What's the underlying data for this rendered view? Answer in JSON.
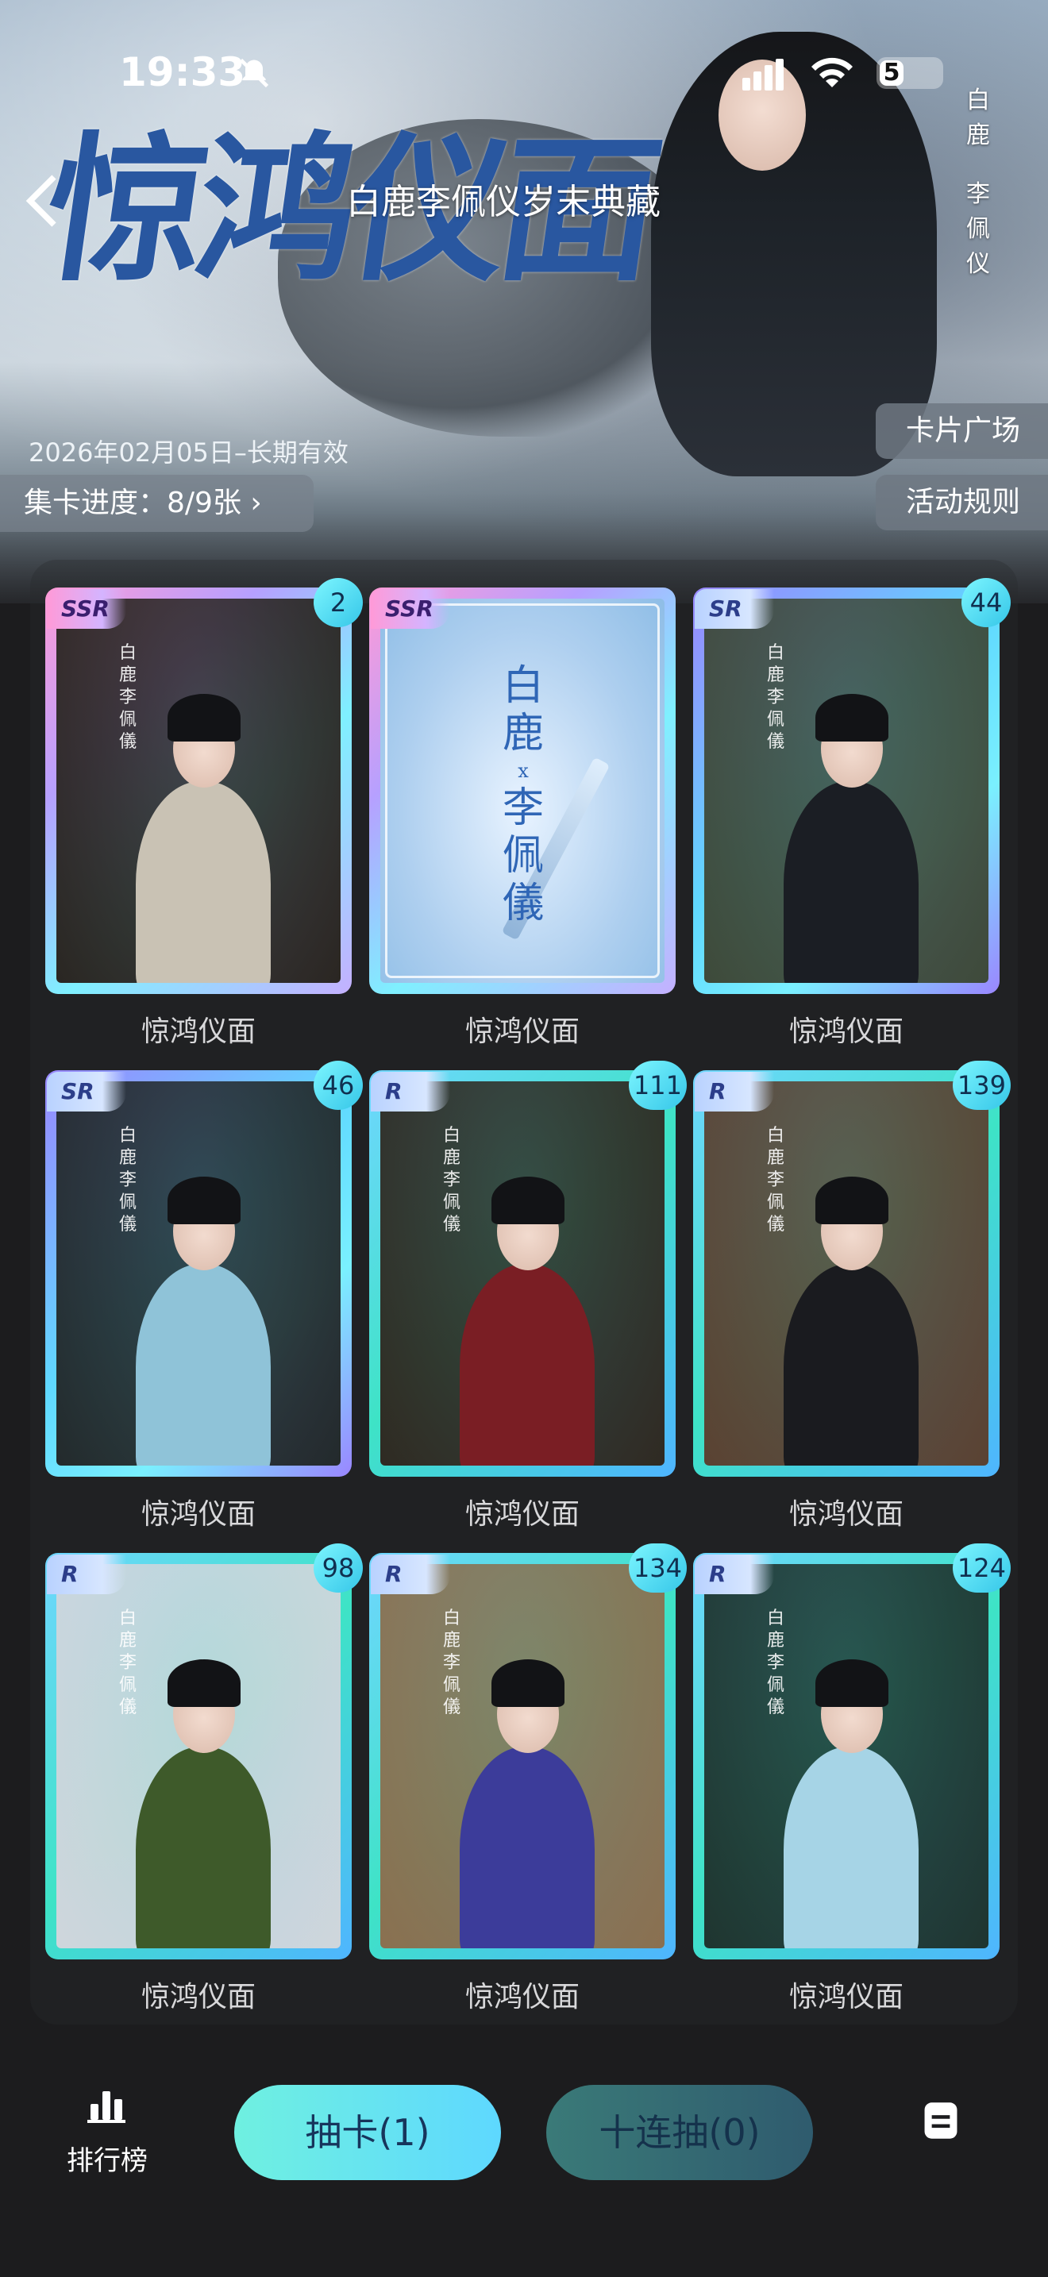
{
  "status_bar": {
    "time": "19:33",
    "battery": "5"
  },
  "header": {
    "calligraphy_title": "惊鸿仪面",
    "page_title": "白鹿李佩仪岁末典藏",
    "vertical_names": [
      "白",
      "鹿",
      "李",
      "佩",
      "仪"
    ],
    "valid_date": "2026年02月05日–长期有效",
    "progress": "集卡进度：8/9张 ›",
    "card_plaza": "卡片广场",
    "rules": "活动规则"
  },
  "cards": [
    {
      "name": "惊鸿仪面",
      "rarity": "SSR",
      "count": "2",
      "tone": "#c9c2b4",
      "bg": "#2a2622"
    },
    {
      "name": "惊鸿仪面",
      "rarity": "SSR",
      "count": "",
      "cover": {
        "line1": "白",
        "line2": "鹿",
        "x": "x",
        "line3": "李",
        "line4": "佩",
        "line5": "儀"
      }
    },
    {
      "name": "惊鸿仪面",
      "rarity": "SR",
      "count": "44",
      "tone": "#1b1e24",
      "bg": "#3e4a3a"
    },
    {
      "name": "惊鸿仪面",
      "rarity": "SR",
      "count": "46",
      "tone": "#8fc3d8",
      "bg": "#232a2c"
    },
    {
      "name": "惊鸿仪面",
      "rarity": "R",
      "count": "111",
      "tone": "#7a1e24",
      "bg": "#2f2a22"
    },
    {
      "name": "惊鸿仪面",
      "rarity": "R",
      "count": "139",
      "tone": "#1a1b1f",
      "bg": "#5a4232"
    },
    {
      "name": "惊鸿仪面",
      "rarity": "R",
      "count": "98",
      "tone": "#3e5a2a",
      "bg": "#cfd6dc"
    },
    {
      "name": "惊鸿仪面",
      "rarity": "R",
      "count": "134",
      "tone": "#3c3c9a",
      "bg": "#8a7050"
    },
    {
      "name": "惊鸿仪面",
      "rarity": "R",
      "count": "124",
      "tone": "#a6d4e6",
      "bg": "#1f3530"
    }
  ],
  "watermark": [
    "白",
    "鹿",
    "李",
    "佩",
    "儀"
  ],
  "bottom": {
    "ranking_label": "排行榜",
    "draw_label": "抽卡(1)",
    "draw10_label": "十连抽(0)"
  }
}
